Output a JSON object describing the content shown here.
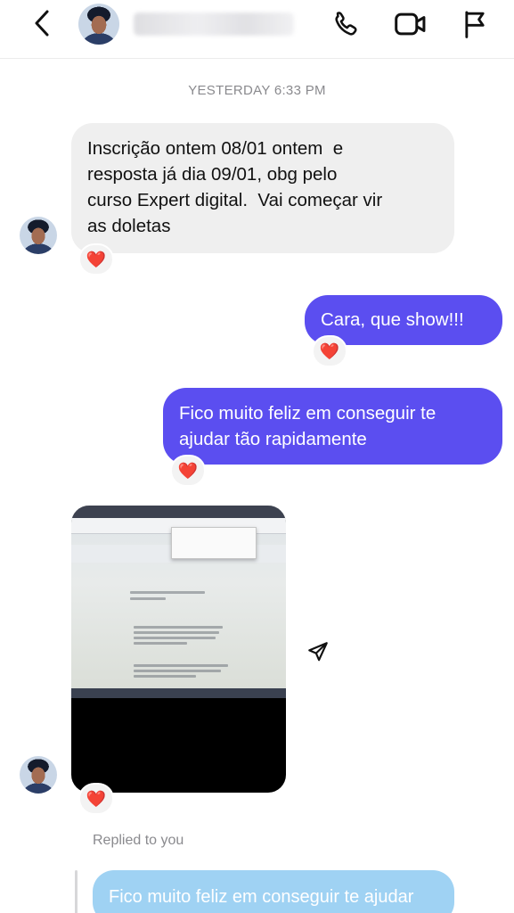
{
  "header": {
    "back_icon": "chevron-left-icon",
    "contact_name_blurred": "",
    "actions": [
      "phone-icon",
      "video-camera-icon",
      "flag-icon"
    ]
  },
  "timestamp": "YESTERDAY 6:33 PM",
  "messages": [
    {
      "direction": "in",
      "lines": [
        "Inscrição ontem 08/01 ontem  e",
        "resposta já dia 09/01, obg pelo",
        "curso Expert digital.  Vai começar vir",
        "as doletas"
      ],
      "reaction": "❤️"
    },
    {
      "direction": "out",
      "lines": [
        "Cara, que show!!!"
      ],
      "reaction": "❤️"
    },
    {
      "direction": "out",
      "lines": [
        "Fico muito feliz em conseguir te",
        "ajudar tão rapidamente"
      ],
      "reaction": "❤️"
    },
    {
      "direction": "in",
      "type": "image",
      "description": "screenshot",
      "reaction": "❤️"
    }
  ],
  "reply": {
    "label": "Replied to you",
    "quoted_text": "Fico muito feliz em conseguir te ajudar"
  },
  "colors": {
    "outgoing_bubble": "#5b4ef0",
    "incoming_bubble": "#efefef",
    "reply_preview": "#9fd2f3"
  }
}
